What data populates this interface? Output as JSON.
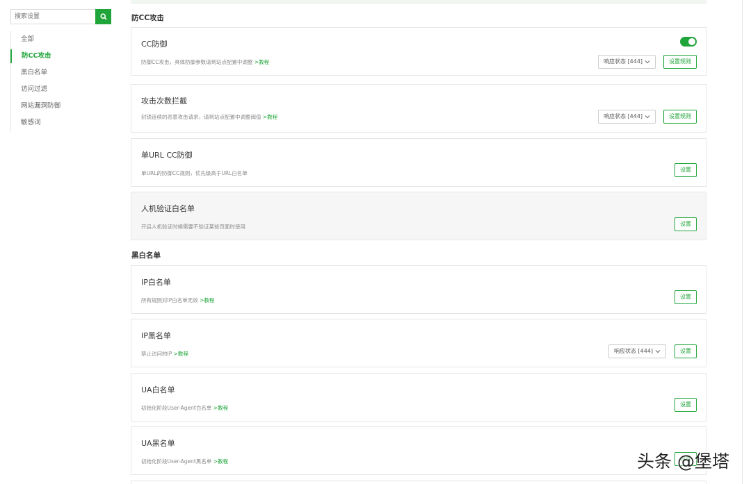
{
  "search": {
    "placeholder": "搜索设置"
  },
  "nav": {
    "items": [
      {
        "label": "全部"
      },
      {
        "label": "防CC攻击"
      },
      {
        "label": "黑白名单"
      },
      {
        "label": "访问过滤"
      },
      {
        "label": "网站漏洞防御"
      },
      {
        "label": "敏感词"
      }
    ],
    "active_index": 1
  },
  "sections": {
    "cc": "防CC攻击",
    "blackwhite": "黑白名单"
  },
  "cards": {
    "cc_defense": {
      "title": "CC防御",
      "desc": "防御CC攻击，具体防御参数请到站点配置中调整",
      "link": ">教程",
      "select": "响应状态 [444]",
      "button": "设置规则",
      "toggle_on": true
    },
    "attack_count": {
      "title": "攻击次数拦截",
      "desc": "封锁连续的恶意攻击请求，请到站点配置中调整阈值",
      "link": ">教程",
      "select": "响应状态 [444]",
      "button": "设置规则"
    },
    "single_url": {
      "title": "单URL CC防御",
      "desc": "单URL的防御CC规则，优先级高于URL白名单",
      "button": "设置"
    },
    "captcha_white": {
      "title": "人机验证白名单",
      "desc": "开启人机验证时候需要不验证某些页面时使用",
      "button": "设置"
    },
    "ip_white": {
      "title": "IP白名单",
      "desc": "所有规则对IP白名单无效",
      "link": ">教程",
      "button": "设置"
    },
    "ip_black": {
      "title": "IP黑名单",
      "desc": "禁止访问的IP",
      "link": ">教程",
      "select": "响应状态 [444]",
      "button": "设置"
    },
    "ua_white": {
      "title": "UA白名单",
      "desc": "初始化阶段User-Agent白名单",
      "link": ">教程",
      "button": "设置"
    },
    "ua_black": {
      "title": "UA黑名单",
      "desc": "初始化阶段User-Agent黑名单",
      "link": ">教程",
      "button": "设置"
    }
  },
  "watermark": "头条 @堡塔",
  "colors": {
    "accent": "#20a53a",
    "border": "#e6e6e6"
  }
}
